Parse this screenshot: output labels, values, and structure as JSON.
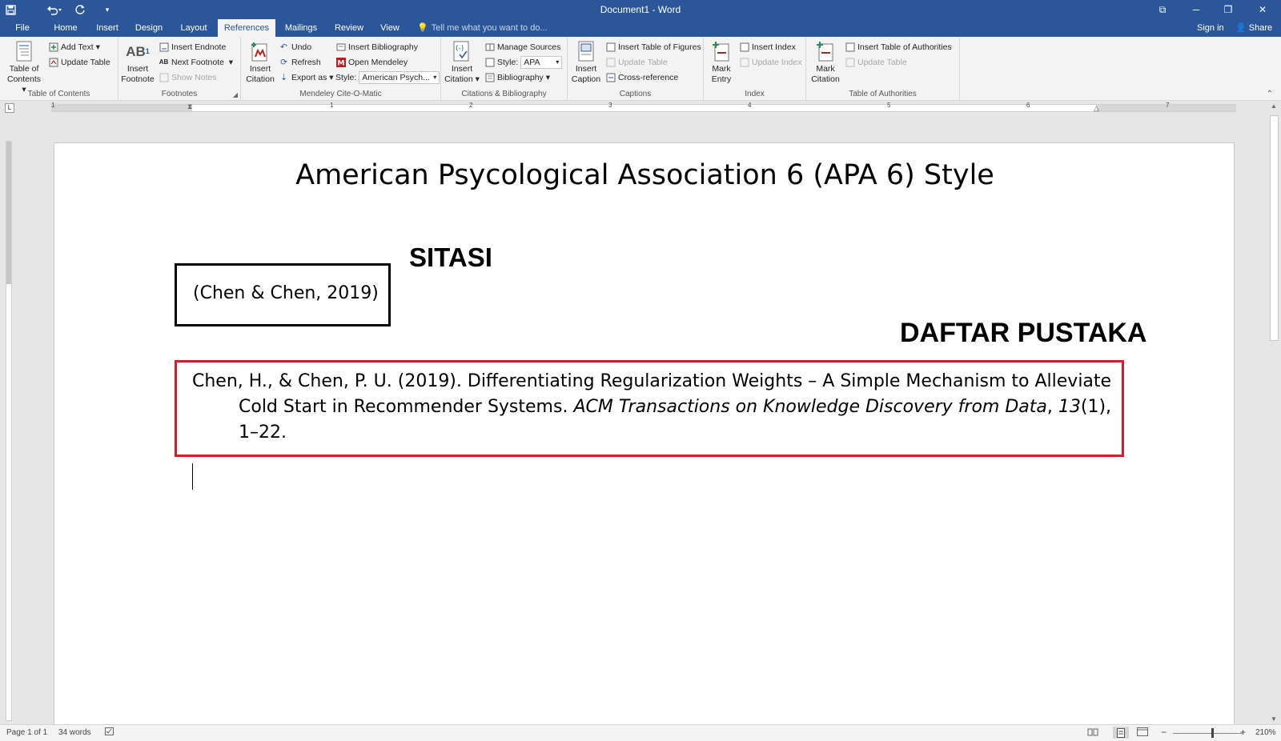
{
  "window": {
    "title": "Document1 - Word",
    "restore_glyph": "⧉",
    "minimize_glyph": "─",
    "maximize_glyph": "❐",
    "close_glyph": "✕"
  },
  "qat": {
    "save_icon": "save-icon",
    "undo_icon": "undo-icon",
    "redo_icon": "redo-icon",
    "customize_glyph": "▾"
  },
  "tabs": [
    {
      "label": "File"
    },
    {
      "label": "Home"
    },
    {
      "label": "Insert"
    },
    {
      "label": "Design"
    },
    {
      "label": "Layout"
    },
    {
      "label": "References"
    },
    {
      "label": "Mailings"
    },
    {
      "label": "Review"
    },
    {
      "label": "View"
    }
  ],
  "active_tab": "References",
  "tell_me": {
    "placeholder": "Tell me what you want to do..."
  },
  "account": {
    "sign_in": "Sign in",
    "share": "Share"
  },
  "ribbon": {
    "toc": {
      "group_label": "Table of Contents",
      "table_of_contents": "Table of Contents",
      "add_text": "Add Text",
      "update_table": "Update Table"
    },
    "footnotes": {
      "group_label": "Footnotes",
      "insert_footnote": "Insert Footnote",
      "insert_endnote": "Insert Endnote",
      "next_footnote": "Next Footnote",
      "show_notes": "Show Notes"
    },
    "mendeley": {
      "group_label": "Mendeley Cite-O-Matic",
      "insert_citation": "Insert Citation",
      "undo": "Undo",
      "refresh": "Refresh",
      "export_as": "Export as",
      "insert_bibliography": "Insert Bibliography",
      "open_mendeley": "Open Mendeley",
      "style_label": "Style:",
      "style_value": "American Psych..."
    },
    "citations": {
      "group_label": "Citations & Bibliography",
      "insert_citation": "Insert Citation",
      "manage_sources": "Manage Sources",
      "style_label": "Style:",
      "style_value": "APA",
      "bibliography": "Bibliography"
    },
    "captions": {
      "group_label": "Captions",
      "insert_caption": "Insert Caption",
      "insert_table_of_figures": "Insert Table of Figures",
      "update_table": "Update Table",
      "cross_reference": "Cross-reference"
    },
    "index": {
      "group_label": "Index",
      "mark_entry": "Mark Entry",
      "insert_index": "Insert Index",
      "update_index": "Update Index"
    },
    "authorities": {
      "group_label": "Table of Authorities",
      "mark_citation": "Mark Citation",
      "insert_table_of_authorities": "Insert Table of Authorities",
      "update_table": "Update Table"
    }
  },
  "ruler": {
    "numbers": [
      "1",
      "1",
      "2",
      "3",
      "4",
      "5",
      "6",
      "7"
    ],
    "tab_selector": "L"
  },
  "document": {
    "heading": "American Psycological Association 6 (APA 6) Style",
    "sitasi_heading": "SITASI",
    "citation": "(Chen & Chen, 2019)",
    "daftar_heading": "DAFTAR PUSTAKA",
    "reference": {
      "authors_title": "Chen, H., & Chen, P. U. (2019). Differentiating Regularization Weights – A Simple Mechanism to Alleviate Cold Start in Recommender Systems. ",
      "journal": "ACM Transactions on Knowledge Discovery from Data",
      "comma": ", ",
      "volume": "13",
      "issue_pages": "(1), 1–22."
    }
  },
  "status": {
    "page": "Page 1 of 1",
    "words": "34 words",
    "zoom": "210%",
    "zoom_minus": "−",
    "zoom_plus": "+"
  },
  "colors": {
    "title_bar": "#2b579a",
    "ribbon": "#f3f3f3",
    "reference_box_border": "#d0202e",
    "citation_box_border": "#000000"
  }
}
